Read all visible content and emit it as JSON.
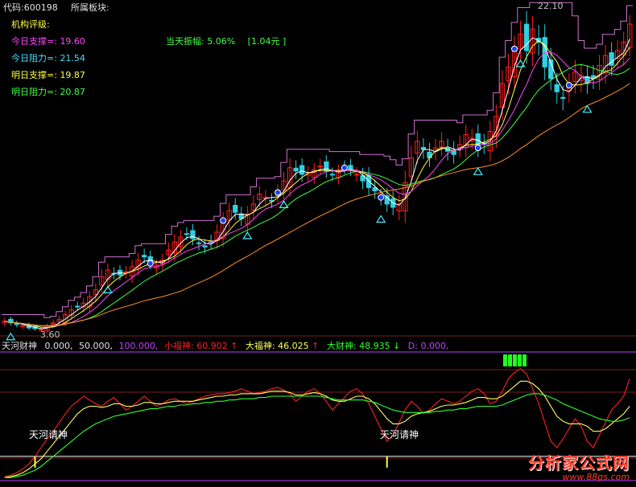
{
  "header": {
    "code_label": "代码:600198",
    "sector_label": "所属板块:",
    "max_price_label": "22.10",
    "min_price_label": "3.60"
  },
  "rating": {
    "title": "机构评级:",
    "items": [
      {
        "label": "今日支撑=:",
        "value": "19.60",
        "color": "#ff44ff"
      },
      {
        "label": "今日阻力=:",
        "value": "21.54",
        "color": "#44ddff"
      },
      {
        "label": "明日支撑=:",
        "value": "19.87",
        "color": "#ffff44"
      },
      {
        "label": "明日阻力=:",
        "value": "20.87",
        "color": "#44ff44"
      }
    ],
    "amplitude_label": "当天振幅:",
    "amplitude_value": "5.06%",
    "amplitude_amount": "[1.04元 ]"
  },
  "indicator_bar": {
    "name": "天河财神",
    "v1": "0.000,",
    "v2": "50.000,",
    "v3": "100.000,",
    "xiaofu_label": "小福神:",
    "xiaofu_value": "60.902",
    "xiaofu_arrow": "↑",
    "dafu_label": "大福神:",
    "dafu_value": "46.025",
    "dafu_arrow": "↑",
    "dacai_label": "大财神:",
    "dacai_value": "48.935",
    "dacai_arrow": "↓",
    "d_label": "D:",
    "d_value": "0.000,"
  },
  "annotations": {
    "signal1": "天河请神",
    "signal2": "天河请神"
  },
  "watermark": {
    "main": "分析家公式网",
    "url": "www.88gs.com"
  },
  "colors": {
    "up": "#ff2020",
    "down": "#30d0e0",
    "ma_white": "#ffffff",
    "ma_yellow": "#ffff40",
    "ma_magenta": "#ff40ff",
    "ma_green": "#40ff40",
    "ma_orange": "#ff9020",
    "resistance": "#d070d0",
    "osc_red": "#ff2020",
    "osc_yellow": "#ffff60",
    "osc_green": "#30ff30",
    "baseline": "#ffffff"
  },
  "chart_data": [
    {
      "type": "candlestick",
      "y_range": [
        3.6,
        22.1
      ],
      "closes": [
        4.1,
        4.0,
        3.9,
        3.85,
        3.7,
        3.65,
        3.6,
        3.8,
        4.0,
        4.2,
        4.5,
        4.8,
        5.0,
        5.2,
        5.6,
        6.0,
        6.8,
        7.2,
        7.0,
        6.9,
        7.1,
        7.4,
        7.8,
        8.0,
        7.6,
        7.5,
        7.8,
        8.4,
        8.9,
        9.2,
        9.4,
        9.1,
        8.8,
        8.6,
        8.9,
        9.5,
        10.2,
        10.8,
        10.7,
        10.3,
        10.6,
        11.2,
        11.8,
        11.6,
        11.4,
        11.9,
        12.6,
        13.4,
        13.2,
        13.0,
        13.1,
        13.3,
        13.5,
        13.2,
        13.0,
        13.2,
        13.4,
        13.3,
        13.0,
        12.6,
        12.2,
        12.0,
        11.6,
        11.2,
        11.0,
        11.2,
        12.5,
        14.0,
        15.0,
        14.5,
        14.0,
        14.6,
        15.0,
        14.4,
        14.2,
        14.8,
        15.4,
        15.2,
        14.6,
        14.8,
        15.6,
        16.5,
        18.5,
        19.5,
        20.6,
        21.5,
        20.5,
        21.8,
        21.0,
        19.5,
        18.8,
        18.0,
        17.6,
        18.4,
        19.2,
        19.0,
        18.5,
        18.8,
        19.6,
        20.2,
        19.6,
        20.5,
        21.0,
        22.1
      ],
      "volatility": [
        0.25,
        0.2,
        0.2,
        0.2,
        0.15,
        0.15,
        0.15,
        0.2,
        0.25,
        0.3,
        0.3,
        0.35,
        0.35,
        0.4,
        0.4,
        0.5,
        0.55,
        0.5,
        0.45,
        0.4,
        0.45,
        0.5,
        0.55,
        0.5,
        0.45,
        0.45,
        0.5,
        0.6,
        0.6,
        0.55,
        0.5,
        0.5,
        0.5,
        0.5,
        0.55,
        0.6,
        0.65,
        0.6,
        0.55,
        0.55,
        0.6,
        0.65,
        0.6,
        0.55,
        0.55,
        0.6,
        0.7,
        0.7,
        0.6,
        0.55,
        0.5,
        0.5,
        0.55,
        0.5,
        0.5,
        0.5,
        0.5,
        0.5,
        0.55,
        0.6,
        0.6,
        0.6,
        0.6,
        0.6,
        0.6,
        0.7,
        0.9,
        0.9,
        0.8,
        0.7,
        0.7,
        0.7,
        0.7,
        0.7,
        0.7,
        0.7,
        0.75,
        0.7,
        0.7,
        0.7,
        0.8,
        0.9,
        1.0,
        1.0,
        1.0,
        1.0,
        1.0,
        1.0,
        1.0,
        1.0,
        0.9,
        0.9,
        0.9,
        0.9,
        0.9,
        0.9,
        0.8,
        0.8,
        0.8,
        0.8,
        0.8,
        0.8,
        0.8,
        0.7
      ]
    },
    {
      "type": "line",
      "y_range": [
        0,
        100
      ],
      "series": [
        {
          "name": "小福神",
          "color": "#ff2020",
          "values": [
            2,
            3,
            5,
            8,
            12,
            18,
            25,
            32,
            38,
            45,
            52,
            58,
            62,
            66,
            63,
            60,
            58,
            62,
            65,
            60,
            55,
            58,
            62,
            66,
            62,
            58,
            60,
            63,
            64,
            62,
            60,
            62,
            64,
            66,
            67,
            68,
            68,
            69,
            70,
            72,
            70,
            68,
            69,
            70,
            72,
            73,
            71,
            68,
            62,
            66,
            70,
            72,
            68,
            62,
            55,
            60,
            65,
            70,
            72,
            68,
            60,
            50,
            40,
            30,
            35,
            45,
            55,
            62,
            58,
            52,
            55,
            60,
            64,
            62,
            60,
            62,
            66,
            70,
            72,
            68,
            60,
            62,
            70,
            80,
            85,
            88,
            84,
            72,
            60,
            45,
            30,
            25,
            32,
            40,
            48,
            42,
            30,
            25,
            35,
            45,
            55,
            60,
            66,
            80
          ]
        },
        {
          "name": "大福神",
          "color": "#ffff60",
          "values": [
            1,
            2,
            3,
            5,
            8,
            12,
            16,
            22,
            28,
            34,
            40,
            46,
            52,
            56,
            58,
            58,
            57,
            58,
            60,
            60,
            58,
            58,
            59,
            61,
            61,
            60,
            60,
            61,
            62,
            62,
            62,
            62,
            63,
            64,
            65,
            66,
            66,
            67,
            67,
            68,
            68,
            68,
            68,
            69,
            70,
            70,
            70,
            69,
            67,
            67,
            68,
            69,
            68,
            66,
            63,
            62,
            62,
            64,
            66,
            66,
            64,
            60,
            54,
            48,
            44,
            44,
            46,
            50,
            52,
            53,
            54,
            56,
            58,
            59,
            59,
            60,
            61,
            63,
            65,
            65,
            64,
            64,
            66,
            70,
            74,
            78,
            78,
            76,
            72,
            66,
            58,
            50,
            46,
            44,
            44,
            44,
            42,
            38,
            38,
            40,
            44,
            48,
            52,
            58
          ]
        },
        {
          "name": "大财神",
          "color": "#30ff30",
          "values": [
            1,
            1,
            2,
            3,
            5,
            7,
            10,
            14,
            18,
            22,
            26,
            30,
            34,
            38,
            41,
            44,
            46,
            48,
            50,
            51,
            52,
            53,
            54,
            55,
            56,
            56,
            57,
            58,
            58,
            59,
            59,
            60,
            60,
            61,
            61,
            62,
            62,
            63,
            63,
            64,
            64,
            64,
            65,
            65,
            66,
            66,
            66,
            66,
            66,
            66,
            66,
            66,
            66,
            65,
            64,
            63,
            63,
            63,
            63,
            63,
            62,
            61,
            59,
            57,
            55,
            54,
            53,
            53,
            53,
            53,
            53,
            54,
            54,
            55,
            55,
            56,
            56,
            57,
            58,
            58,
            58,
            58,
            59,
            61,
            63,
            65,
            67,
            68,
            68,
            67,
            65,
            63,
            60,
            58,
            56,
            54,
            52,
            50,
            48,
            47,
            46,
            46,
            47,
            49
          ]
        }
      ],
      "baseline": 18,
      "signals": [
        5,
        63
      ]
    }
  ]
}
